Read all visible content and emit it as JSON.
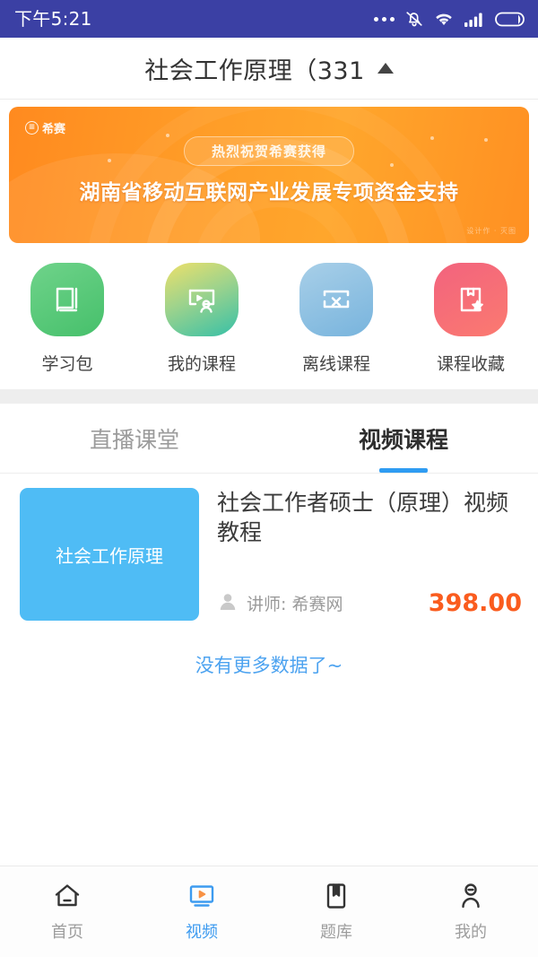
{
  "status_bar": {
    "time": "下午5:21",
    "icons": [
      "more-dots-icon",
      "mute-bell-icon",
      "wifi-icon",
      "signal-icon",
      "battery-icon"
    ],
    "background_color": "#3b40a4"
  },
  "header": {
    "title": "社会工作原理（331",
    "dropdown_icon": "caret-up-icon"
  },
  "banner": {
    "logo_text": "希赛",
    "pill_text": "热烈祝贺希赛获得",
    "headline": "湖南省移动互联网产业发展专项资金支持",
    "watermark": "设计作 · 灭图",
    "gradient_from": "#ff8a1f",
    "gradient_to": "#ffa62c"
  },
  "quick_actions": [
    {
      "label": "学习包",
      "icon": "book-icon",
      "color": "#46c06b"
    },
    {
      "label": "我的课程",
      "icon": "video-person-icon",
      "color": "#36c0a7"
    },
    {
      "label": "离线课程",
      "icon": "screen-x-icon",
      "color": "#78b4dd"
    },
    {
      "label": "课程收藏",
      "icon": "book-star-icon",
      "color": "#fb7a70"
    }
  ],
  "tabs": [
    {
      "label": "直播课堂",
      "active": false
    },
    {
      "label": "视频课程",
      "active": true
    }
  ],
  "tab_accent_color": "#2f9cf2",
  "courses": [
    {
      "thumb_text": "社会工作原理",
      "thumb_color": "#4fbcf5",
      "title": "社会工作者硕士（原理）视频教程",
      "teacher_icon": "person-icon",
      "teacher": "讲师: 希赛网",
      "price": "398.00",
      "price_color": "#fa5c1e"
    }
  ],
  "list_footer": "没有更多数据了~",
  "bottom_nav": [
    {
      "label": "首页",
      "icon": "home-icon",
      "active": false
    },
    {
      "label": "视频",
      "icon": "video-icon",
      "active": true
    },
    {
      "label": "题库",
      "icon": "bookmark-icon",
      "active": false
    },
    {
      "label": "我的",
      "icon": "user-icon",
      "active": false
    }
  ]
}
